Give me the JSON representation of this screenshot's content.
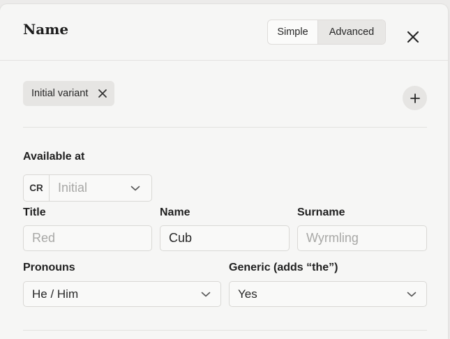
{
  "header": {
    "title": "Name",
    "mode_simple": "Simple",
    "mode_advanced": "Advanced",
    "active_mode": "Advanced"
  },
  "variant_chip": {
    "label": "Initial variant"
  },
  "available_at": {
    "label": "Available at",
    "prefix": "CR",
    "value": "Initial"
  },
  "fields": {
    "title": {
      "label": "Title",
      "placeholder": "Red"
    },
    "name": {
      "label": "Name",
      "value": "Cub"
    },
    "surname": {
      "label": "Surname",
      "placeholder": "Wyrmling"
    },
    "pronouns": {
      "label": "Pronouns",
      "value": "He / Him"
    },
    "generic": {
      "label": "Generic (adds “the”)",
      "value": "Yes"
    }
  },
  "icons": {
    "close": "close-icon",
    "chip_remove": "close-icon",
    "add": "plus-icon",
    "dropdown": "chevron-down-icon"
  }
}
